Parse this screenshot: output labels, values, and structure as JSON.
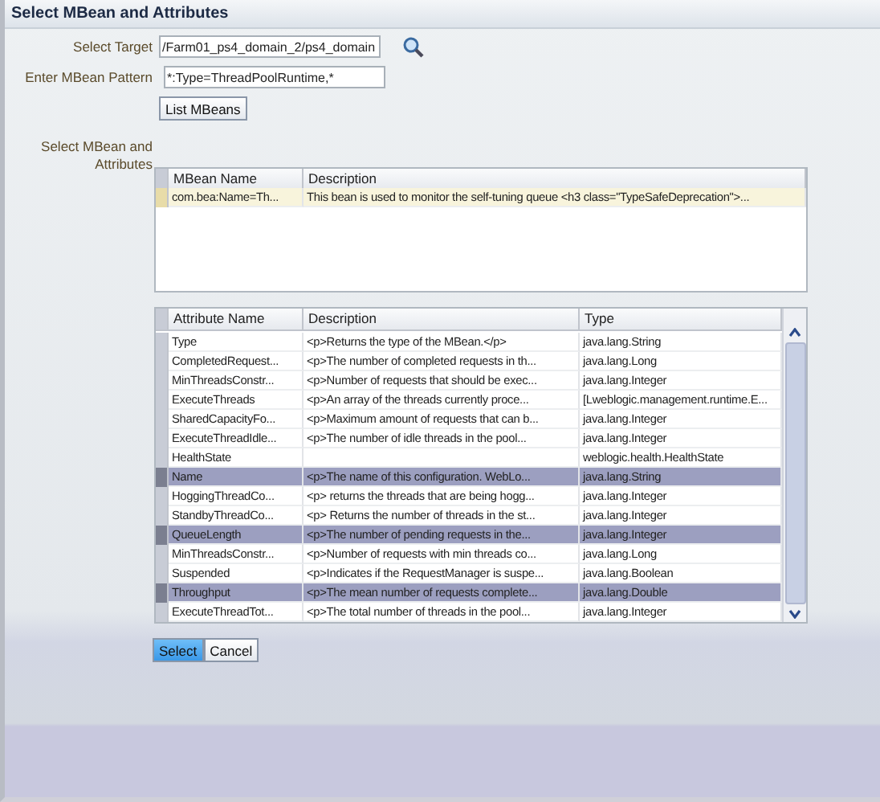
{
  "window": {
    "title": "Select MBean and Attributes"
  },
  "target": {
    "label": "Select Target",
    "value": "/Farm01_ps4_domain_2/ps4_domain"
  },
  "pattern": {
    "label": "Enter MBean Pattern",
    "value": "*:Type=ThreadPoolRuntime,*"
  },
  "list_button": "List MBeans",
  "mbean_label": "Select MBean and Attributes",
  "mbean_table": {
    "columns": [
      "MBean Name",
      "Description"
    ],
    "rows": [
      {
        "cells": [
          "com.bea:Name=Th...",
          "This bean is used to monitor the self-tuning queue <h3 class=\"TypeSafeDeprecation\">..."
        ],
        "selected": true
      }
    ]
  },
  "attribute_table": {
    "columns": [
      "Attribute Name",
      "Description",
      "Type"
    ],
    "rows": [
      {
        "cells": [
          "Type",
          "<p>Returns the type of the MBean.</p>",
          "java.lang.String"
        ],
        "selected": false
      },
      {
        "cells": [
          "CompletedRequest...",
          "<p>The number of completed requests in th...",
          "java.lang.Long"
        ],
        "selected": false
      },
      {
        "cells": [
          "MinThreadsConstr...",
          "<p>Number of requests that should be exec...",
          "java.lang.Integer"
        ],
        "selected": false
      },
      {
        "cells": [
          "ExecuteThreads",
          "<p>An array of the threads currently proce...",
          "[Lweblogic.management.runtime.E..."
        ],
        "selected": false
      },
      {
        "cells": [
          "SharedCapacityFo...",
          "<p>Maximum amount of requests that can b...",
          "java.lang.Integer"
        ],
        "selected": false
      },
      {
        "cells": [
          "ExecuteThreadIdle...",
          "<p>The number of idle threads in the pool...",
          "java.lang.Integer"
        ],
        "selected": false
      },
      {
        "cells": [
          "HealthState",
          "",
          "weblogic.health.HealthState"
        ],
        "selected": false
      },
      {
        "cells": [
          "Name",
          "<p>The name of this configuration. WebLo...",
          "java.lang.String"
        ],
        "selected": true
      },
      {
        "cells": [
          "HoggingThreadCo...",
          "<p> returns the threads that are being hogg...",
          "java.lang.Integer"
        ],
        "selected": false
      },
      {
        "cells": [
          "StandbyThreadCo...",
          "<p> Returns the number of threads in the st...",
          "java.lang.Integer"
        ],
        "selected": false
      },
      {
        "cells": [
          "QueueLength",
          "<p>The number of pending requests in the...",
          "java.lang.Integer"
        ],
        "selected": true
      },
      {
        "cells": [
          "MinThreadsConstr...",
          "<p>Number of requests with min threads co...",
          "java.lang.Long"
        ],
        "selected": false
      },
      {
        "cells": [
          "Suspended",
          "<p>Indicates if the RequestManager is suspe...",
          "java.lang.Boolean"
        ],
        "selected": false
      },
      {
        "cells": [
          "Throughput",
          "<p>The mean number of requests complete...",
          "java.lang.Double"
        ],
        "selected": true
      },
      {
        "cells": [
          "ExecuteThreadTot...",
          "<p>The total number of threads in the pool...",
          "java.lang.Integer"
        ],
        "selected": false
      }
    ]
  },
  "buttons": [
    {
      "label": "Select",
      "kind": "primary"
    },
    {
      "label": "Cancel",
      "kind": "secondary"
    }
  ]
}
